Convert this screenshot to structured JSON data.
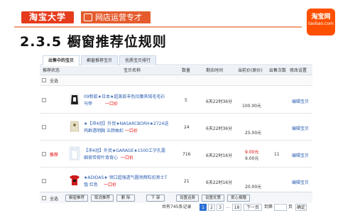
{
  "header": {
    "logo_text": "淘宝大学",
    "sub_logo_text": "网店运营专才",
    "brand_main": "淘宝网",
    "brand_sub": "taobao.com"
  },
  "slide_title": "2.3.5 橱窗推荐位规则",
  "tabs": [
    {
      "label": "出售中的宝贝",
      "active": true
    },
    {
      "label": "橱窗推荐宝贝",
      "active": false
    },
    {
      "label": "优质宝贝排行",
      "active": false
    }
  ],
  "table_header": {
    "status": "推荐状态",
    "name": "宝贝名称",
    "quantity": "数量",
    "remaining": "剩余时间",
    "price": "当前价(原价)",
    "sold": "出售次数",
    "action": "修改设置"
  },
  "select_all_label": "全选",
  "rows": [
    {
      "status": "",
      "name_line1": "09新款★日本★超美款丰色扣腰夹绒毛毛衫",
      "name_line2": "马甲",
      "one_price": "一口价",
      "quantity": "5",
      "remaining": "6天22时36分",
      "price": "100.00元",
      "orig_price": "",
      "sold": "",
      "action": "编辑宝贝"
    },
    {
      "status": "",
      "name_line1": "★【冲4冠】外贸★NASARCBORH★2724送",
      "name_line2": "鸡群透明胸 五颜抽扣",
      "one_price": "一口价",
      "quantity": "24",
      "remaining": "6天22时36分",
      "price": "25.00元",
      "orig_price": "",
      "sold": "",
      "action": "编辑宝贝"
    },
    {
      "status": "推荐",
      "name_line1": "【冲4冠】外贸★GARAGE★1500工字孔露",
      "name_line2": "细背带荷叶背背心",
      "one_price": "一口价",
      "quantity": "716",
      "remaining": "6天22时16分",
      "price": "9.00元",
      "orig_price": "9.00元",
      "sold": "11",
      "action": "编辑宝贝"
    },
    {
      "status": "",
      "name_line1": "★ADIDAS★ 领口超强透气圆领两粒扣男士T",
      "name_line2": "恤 红色",
      "one_price": "一口价",
      "quantity": "21",
      "remaining": "6天22时16分",
      "price": "20.00元",
      "orig_price": "",
      "sold": "",
      "action": "编辑宝贝"
    }
  ],
  "bottom_buttons": [
    "橱窗推荐",
    "取消推荐",
    "删 除",
    "下 架",
    "设置运费",
    "设置优惠",
    "爱心捐赠"
  ],
  "pager": {
    "summary": "共有745条记录",
    "pages": [
      "1",
      "2",
      "3",
      "...",
      "18"
    ],
    "active_page": "1",
    "next": "下一页",
    "jump_label": "到第",
    "page_unit": "页",
    "go": "确定"
  },
  "colors": {
    "brand_red": "#e53b1c",
    "taobao_orange": "#ff5000",
    "link_blue": "#2a5db0",
    "price_red": "#e60000"
  }
}
